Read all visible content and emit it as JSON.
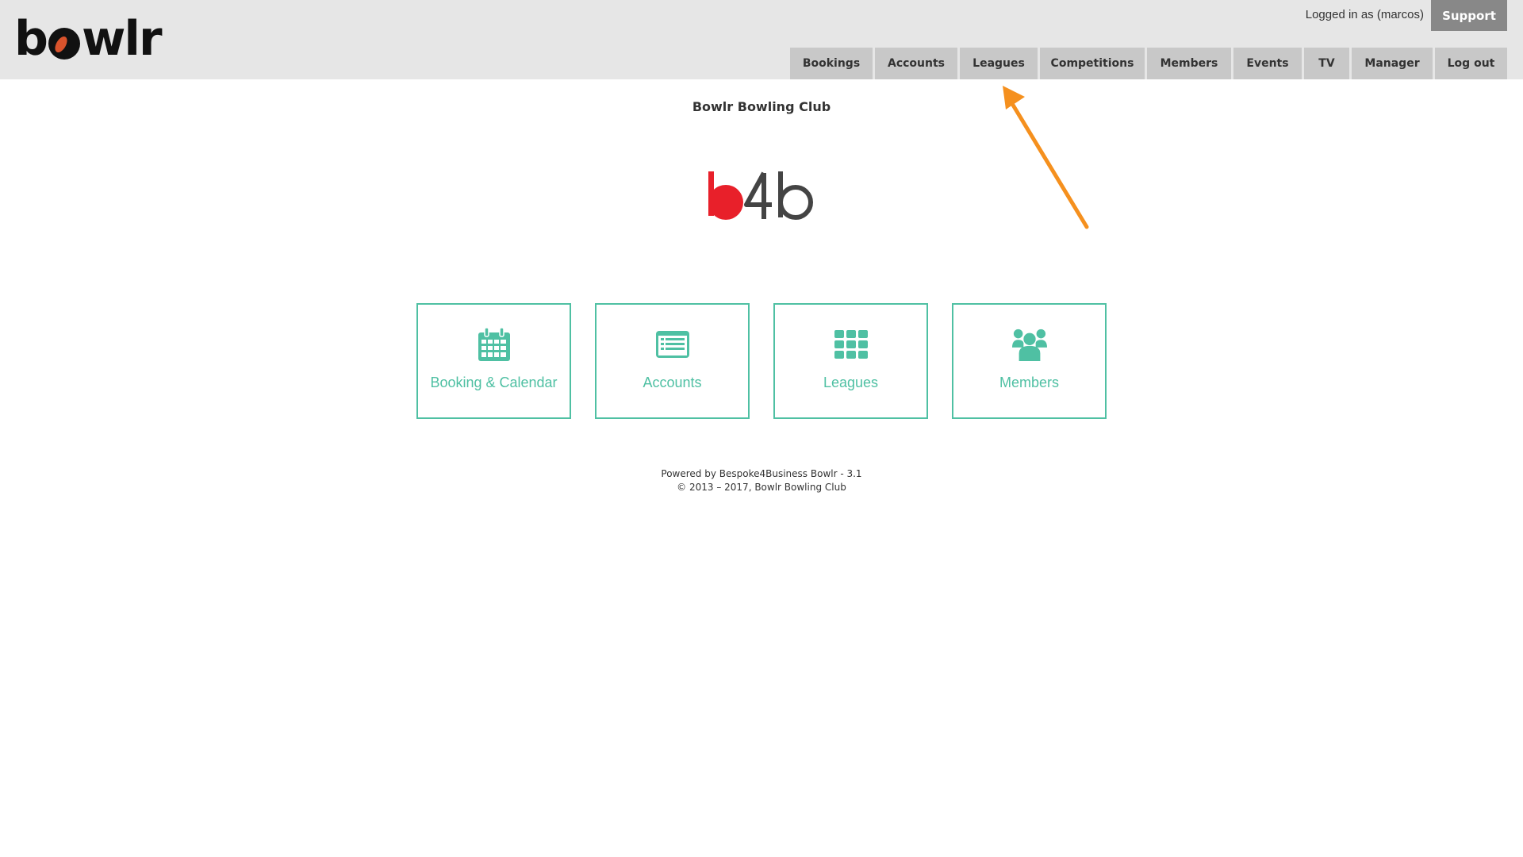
{
  "header": {
    "logo_text": "bowlr",
    "login_status": "Logged in as (marcos)",
    "support_label": "Support",
    "nav": [
      {
        "label": "Bookings",
        "width": 104
      },
      {
        "label": "Accounts",
        "width": 104
      },
      {
        "label": "Leagues",
        "width": 98
      },
      {
        "label": "Competitions",
        "width": 132
      },
      {
        "label": "Members",
        "width": 106
      },
      {
        "label": "Events",
        "width": 86
      },
      {
        "label": "TV",
        "width": 57
      },
      {
        "label": "Manager",
        "width": 102
      },
      {
        "label": "Log out",
        "width": 91
      }
    ]
  },
  "main": {
    "club_name": "Bowlr Bowling Club",
    "brand_logo_text": "b4b",
    "tiles": [
      {
        "label": "Booking & Calendar",
        "icon": "calendar-icon"
      },
      {
        "label": "Accounts",
        "icon": "list-icon"
      },
      {
        "label": "Leagues",
        "icon": "grid-icon"
      },
      {
        "label": "Members",
        "icon": "users-icon"
      }
    ]
  },
  "footer": {
    "line1": "Powered by Bespoke4Business Bowlr - 3.1",
    "line2": "© 2013 – 2017, Bowlr Bowling Club"
  },
  "colors": {
    "accent": "#4fc0a3",
    "header_bg": "#e6e6e6",
    "nav_bg": "#c8c8c8",
    "support_bg": "#888888",
    "annotation": "#f5901e",
    "brand_red": "#e8202a"
  }
}
